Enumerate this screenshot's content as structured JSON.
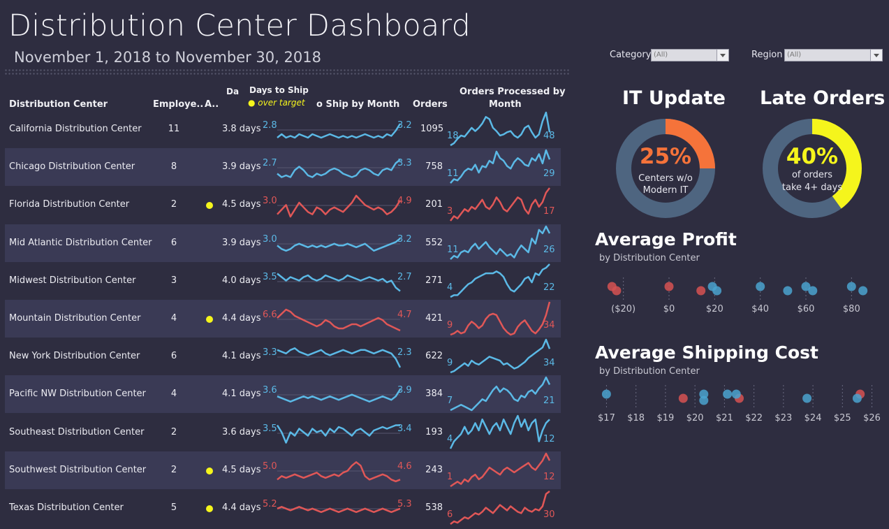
{
  "header": {
    "title": "Distribution Center Dashboard",
    "date_range": "November 1, 2018 to November 30, 2018"
  },
  "filters": [
    {
      "label": "Category",
      "value": "(All)"
    },
    {
      "label": "Region",
      "value": "(All)"
    }
  ],
  "table": {
    "headers": {
      "center": "Distribution Center",
      "employees": "Employe..",
      "alert": "A..",
      "days_cut": "Da",
      "days_title": "Days to Ship",
      "over_target": "over target",
      "ship_by_month": "o Ship by Month",
      "orders": "Orders",
      "orders_by_month_1": "Orders Processed by",
      "orders_by_month_2": "Month"
    },
    "colors": {
      "blue": "#5bb9e6",
      "red": "#e05757",
      "alert": "#f5f51c"
    },
    "rows": [
      {
        "name": "California Distribution Center",
        "employees": "11",
        "alert": false,
        "days": "3.8 days",
        "ship_start": "2.8",
        "ship_end": "3.2",
        "over": false,
        "orders": "1095",
        "ord_start": "18",
        "ord_end": "48",
        "ship": [
          2.8,
          2.9,
          2.8,
          2.85,
          2.8,
          2.9,
          2.85,
          2.8,
          2.9,
          2.85,
          2.8,
          2.85,
          2.9,
          2.85,
          2.8,
          2.85,
          2.8,
          2.85,
          2.8,
          2.85,
          2.9,
          2.85,
          2.8,
          2.85,
          2.8,
          2.9,
          2.85,
          3.0,
          3.2
        ],
        "ord": [
          18,
          20,
          24,
          27,
          26,
          30,
          34,
          31,
          34,
          38,
          44,
          42,
          34,
          31,
          27,
          28,
          30,
          31,
          27,
          25,
          28,
          34,
          36,
          30,
          25,
          28,
          40,
          48,
          30
        ]
      },
      {
        "name": "Chicago Distribution Center",
        "employees": "8",
        "alert": false,
        "days": "3.9 days",
        "ship_start": "2.7",
        "ship_end": "3.3",
        "over": false,
        "orders": "758",
        "ord_start": "11",
        "ord_end": "29",
        "ship": [
          2.9,
          2.8,
          2.85,
          2.8,
          3.0,
          3.1,
          3.0,
          2.85,
          2.8,
          2.9,
          2.85,
          2.9,
          3.0,
          3.05,
          3.0,
          2.9,
          2.85,
          2.8,
          2.85,
          3.0,
          3.05,
          3.0,
          2.9,
          2.85,
          3.0,
          3.05,
          3.0,
          3.2,
          3.3
        ],
        "ord": [
          11,
          14,
          13,
          16,
          20,
          22,
          21,
          25,
          19,
          24,
          23,
          28,
          26,
          35,
          30,
          28,
          24,
          22,
          27,
          30,
          28,
          25,
          24,
          30,
          28,
          33,
          26,
          36,
          29
        ]
      },
      {
        "name": "Florida Distribution Center",
        "employees": "2",
        "alert": true,
        "days": "4.5 days",
        "ship_start": "3.0",
        "ship_end": "4.9",
        "over": true,
        "orders": "201",
        "ord_start": "3",
        "ord_end": "17",
        "ship": [
          4.3,
          4.5,
          4.7,
          4.2,
          4.5,
          4.8,
          4.6,
          4.4,
          4.3,
          4.6,
          4.5,
          4.3,
          4.5,
          4.6,
          4.5,
          4.4,
          4.6,
          4.8,
          5.1,
          4.9,
          4.7,
          4.6,
          4.5,
          4.6,
          4.5,
          4.3,
          4.4,
          4.6,
          4.9
        ],
        "ord": [
          3,
          5,
          4,
          6,
          8,
          7,
          9,
          8,
          10,
          12,
          9,
          8,
          10,
          13,
          11,
          8,
          7,
          9,
          11,
          13,
          12,
          8,
          6,
          10,
          12,
          9,
          11,
          15,
          17
        ]
      },
      {
        "name": "Mid Atlantic Distribution Center",
        "employees": "6",
        "alert": false,
        "days": "3.9 days",
        "ship_start": "3.0",
        "ship_end": "3.2",
        "over": false,
        "orders": "552",
        "ord_start": "11",
        "ord_end": "26",
        "ship": [
          3.0,
          2.9,
          2.85,
          2.9,
          3.0,
          3.05,
          3.0,
          2.95,
          3.0,
          2.95,
          3.0,
          2.95,
          3.0,
          3.05,
          3.0,
          3.0,
          3.05,
          3.0,
          2.95,
          3.0,
          3.05,
          2.95,
          2.85,
          2.9,
          2.95,
          3.0,
          3.05,
          3.1,
          3.2
        ],
        "ord": [
          11,
          13,
          12,
          15,
          16,
          15,
          18,
          20,
          17,
          19,
          21,
          18,
          16,
          14,
          17,
          15,
          13,
          14,
          12,
          16,
          19,
          17,
          15,
          23,
          20,
          28,
          26,
          30,
          26
        ]
      },
      {
        "name": "Midwest Distribution Center",
        "employees": "3",
        "alert": false,
        "days": "4.0 days",
        "ship_start": "3.5",
        "ship_end": "2.7",
        "over": false,
        "orders": "271",
        "ord_start": "4",
        "ord_end": "22",
        "ship": [
          3.2,
          3.1,
          3.0,
          3.1,
          3.05,
          3.0,
          3.1,
          3.15,
          3.05,
          3.0,
          3.05,
          3.15,
          3.1,
          3.05,
          3.0,
          3.05,
          3.15,
          3.1,
          3.05,
          3.0,
          3.05,
          3.1,
          3.05,
          3.0,
          3.05,
          2.95,
          3.0,
          2.8,
          2.7
        ],
        "ord": [
          4,
          5,
          5,
          7,
          9,
          11,
          12,
          14,
          15,
          16,
          17,
          17,
          17,
          18,
          17,
          15,
          11,
          8,
          7,
          9,
          11,
          14,
          15,
          12,
          17,
          16,
          19,
          20,
          22
        ]
      },
      {
        "name": "Mountain Distribution Center",
        "employees": "4",
        "alert": true,
        "days": "4.4 days",
        "ship_start": "6.6",
        "ship_end": "4.7",
        "over": true,
        "orders": "421",
        "ord_start": "9",
        "ord_end": "34",
        "ship": [
          5.3,
          5.5,
          5.7,
          5.6,
          5.4,
          5.3,
          5.2,
          5.1,
          5.0,
          4.9,
          5.0,
          5.2,
          5.1,
          4.9,
          4.8,
          4.8,
          4.9,
          5.0,
          5.0,
          4.9,
          5.0,
          5.1,
          5.2,
          5.3,
          5.2,
          5.0,
          4.9,
          4.8,
          4.7
        ],
        "ord": [
          9,
          10,
          12,
          10,
          11,
          16,
          19,
          17,
          14,
          16,
          21,
          24,
          25,
          24,
          19,
          14,
          11,
          9,
          10,
          15,
          18,
          20,
          16,
          12,
          10,
          13,
          17,
          24,
          34
        ]
      },
      {
        "name": "New York Distribution Center",
        "employees": "6",
        "alert": false,
        "days": "4.1 days",
        "ship_start": "3.3",
        "ship_end": "2.3",
        "over": false,
        "orders": "622",
        "ord_start": "9",
        "ord_end": "34",
        "ship": [
          2.8,
          2.75,
          2.7,
          2.8,
          2.85,
          2.75,
          2.7,
          2.65,
          2.7,
          2.75,
          2.8,
          2.7,
          2.65,
          2.7,
          2.75,
          2.8,
          2.75,
          2.7,
          2.75,
          2.8,
          2.8,
          2.75,
          2.7,
          2.75,
          2.8,
          2.75,
          2.7,
          2.55,
          2.3
        ],
        "ord": [
          9,
          10,
          12,
          14,
          16,
          14,
          18,
          16,
          15,
          17,
          19,
          21,
          20,
          19,
          18,
          15,
          16,
          14,
          12,
          13,
          15,
          17,
          20,
          22,
          24,
          26,
          28,
          34,
          27
        ]
      },
      {
        "name": "Pacific NW Distribution Center",
        "employees": "4",
        "alert": false,
        "days": "4.1 days",
        "ship_start": "3.6",
        "ship_end": "3.9",
        "over": false,
        "orders": "384",
        "ord_start": "7",
        "ord_end": "21",
        "ship": [
          3.7,
          3.65,
          3.6,
          3.55,
          3.6,
          3.65,
          3.7,
          3.65,
          3.7,
          3.65,
          3.6,
          3.65,
          3.7,
          3.65,
          3.6,
          3.65,
          3.7,
          3.75,
          3.7,
          3.65,
          3.6,
          3.55,
          3.6,
          3.65,
          3.7,
          3.65,
          3.6,
          3.7,
          3.9
        ],
        "ord": [
          7,
          8,
          9,
          10,
          9,
          8,
          7,
          9,
          11,
          13,
          12,
          15,
          18,
          20,
          17,
          19,
          18,
          16,
          13,
          12,
          15,
          14,
          17,
          18,
          16,
          19,
          21,
          25,
          21
        ]
      },
      {
        "name": "Southeast Distribution Center",
        "employees": "2",
        "alert": false,
        "days": "3.6 days",
        "ship_start": "3.5",
        "ship_end": "3.4",
        "over": false,
        "orders": "193",
        "ord_start": "4",
        "ord_end": "12",
        "ship": [
          3.4,
          3.2,
          2.9,
          3.2,
          3.1,
          3.3,
          3.2,
          3.1,
          3.3,
          3.2,
          3.25,
          3.1,
          3.3,
          3.2,
          3.35,
          3.3,
          3.2,
          3.1,
          3.25,
          3.3,
          3.2,
          3.1,
          3.25,
          3.3,
          3.35,
          3.3,
          3.35,
          3.4,
          3.4
        ],
        "ord": [
          4,
          6,
          7,
          8,
          10,
          8,
          9,
          11,
          9,
          12,
          10,
          8,
          10,
          11,
          9,
          12,
          10,
          8,
          11,
          13,
          10,
          12,
          9,
          11,
          12,
          6,
          9,
          11,
          12
        ]
      },
      {
        "name": "Southwest Distribution Center",
        "employees": "2",
        "alert": true,
        "days": "4.5 days",
        "ship_start": "5.0",
        "ship_end": "4.6",
        "over": true,
        "orders": "243",
        "ord_start": "1",
        "ord_end": "12",
        "ship": [
          4.8,
          4.9,
          4.85,
          4.9,
          4.95,
          4.9,
          4.85,
          4.9,
          4.95,
          5.0,
          4.9,
          4.85,
          4.9,
          4.95,
          4.9,
          5.0,
          5.05,
          5.2,
          5.3,
          5.2,
          4.9,
          4.8,
          4.85,
          4.9,
          4.95,
          4.9,
          4.8,
          4.75,
          4.8
        ],
        "ord": [
          1,
          2,
          3,
          2,
          4,
          3,
          5,
          6,
          4,
          5,
          7,
          9,
          8,
          7,
          6,
          8,
          9,
          8,
          7,
          8,
          9,
          10,
          11,
          9,
          8,
          10,
          12,
          15,
          12
        ]
      },
      {
        "name": "Texas Distribution Center",
        "employees": "5",
        "alert": true,
        "days": "4.4 days",
        "ship_start": "5.2",
        "ship_end": "5.3",
        "over": true,
        "orders": "538",
        "ord_start": "6",
        "ord_end": "30",
        "ship": [
          5.55,
          5.6,
          5.55,
          5.5,
          5.55,
          5.6,
          5.55,
          5.5,
          5.55,
          5.5,
          5.45,
          5.5,
          5.55,
          5.5,
          5.45,
          5.5,
          5.55,
          5.5,
          5.45,
          5.5,
          5.55,
          5.5,
          5.45,
          5.5,
          5.55,
          5.5,
          5.45,
          5.5,
          5.55
        ],
        "ord": [
          6,
          8,
          7,
          9,
          11,
          10,
          12,
          14,
          13,
          15,
          18,
          16,
          14,
          17,
          20,
          18,
          16,
          19,
          17,
          15,
          14,
          18,
          16,
          15,
          17,
          16,
          19,
          28,
          30
        ]
      }
    ]
  },
  "it_update": {
    "title": "IT Update",
    "percent": "25%",
    "fraction": 0.25,
    "line1": "Centers w/o",
    "line2": "Modern IT",
    "color": "#f5733a",
    "track": "#4e6580"
  },
  "late_orders": {
    "title": "Late Orders",
    "percent": "40%",
    "fraction": 0.4,
    "line1": "of orders",
    "line2": "take 4+ days",
    "color": "#f5f51c",
    "track": "#4e6580"
  },
  "avg_profit": {
    "title": "Average Profit",
    "subtitle": "by Distribution Center",
    "ticks": [
      "($20)",
      "$0",
      "$20",
      "$40",
      "$60",
      "$80"
    ],
    "chart_data": {
      "type": "scatter",
      "xlim": [
        -30,
        90
      ],
      "points": [
        {
          "x": -25,
          "color": "red"
        },
        {
          "x": -23,
          "color": "red"
        },
        {
          "x": 0,
          "color": "red"
        },
        {
          "x": 14,
          "color": "red"
        },
        {
          "x": 19,
          "color": "blue"
        },
        {
          "x": 21,
          "color": "blue"
        },
        {
          "x": 40,
          "color": "blue"
        },
        {
          "x": 52,
          "color": "blue"
        },
        {
          "x": 60,
          "color": "blue"
        },
        {
          "x": 63,
          "color": "blue"
        },
        {
          "x": 80,
          "color": "blue"
        },
        {
          "x": 85,
          "color": "blue"
        }
      ]
    }
  },
  "avg_ship_cost": {
    "title": "Average Shipping Cost",
    "subtitle": "by Distribution Center",
    "ticks": [
      "$17",
      "$18",
      "$19",
      "$20",
      "$21",
      "$22",
      "$23",
      "$24",
      "$25",
      "$26"
    ],
    "chart_data": {
      "type": "scatter",
      "xlim": [
        16.8,
        26.2
      ],
      "points": [
        {
          "x": 17.0,
          "color": "blue"
        },
        {
          "x": 19.6,
          "color": "red"
        },
        {
          "x": 20.3,
          "color": "blue"
        },
        {
          "x": 20.3,
          "color": "blue"
        },
        {
          "x": 21.1,
          "color": "blue"
        },
        {
          "x": 21.5,
          "color": "red"
        },
        {
          "x": 21.4,
          "color": "blue"
        },
        {
          "x": 23.8,
          "color": "blue"
        },
        {
          "x": 25.6,
          "color": "red"
        },
        {
          "x": 25.5,
          "color": "blue"
        }
      ]
    }
  }
}
